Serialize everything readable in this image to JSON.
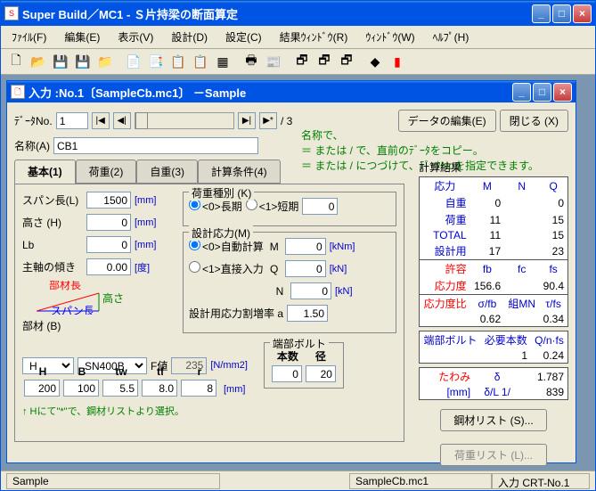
{
  "window": {
    "title": "Super Build／MC1 - Ｓ片持梁の断面算定"
  },
  "menu": {
    "file": "ﾌｧｲﾙ(F)",
    "edit": "編集(E)",
    "view": "表示(V)",
    "design": "設計(D)",
    "settings": "設定(C)",
    "result": "結果ｳｨﾝﾄﾞｳ(R)",
    "win": "ｳｨﾝﾄﾞｳ(W)",
    "help": "ﾍﾙﾌﾟ(H)"
  },
  "subwin": {
    "title": "入力 :No.1〔SampleCb.mc1〕 －Sample"
  },
  "dataNo": {
    "label": "ﾃﾞｰﾀNo.",
    "value": "1",
    "total": "/ 3"
  },
  "hint": {
    "l1": "名称で、",
    "l2": "＝ または / で、直前のﾃﾞｰﾀをコピー。",
    "l3": "＝ または / につづけて、ﾃﾞｰﾀNoを指定できます。"
  },
  "buttons": {
    "edit": "データの編集(E)",
    "close": "閉じる (X)",
    "steel": "鋼材リスト (S)...",
    "load": "荷重リスト (L)..."
  },
  "name": {
    "label": "名称(A)",
    "value": "CB1"
  },
  "tabs": {
    "basic": "基本(1)",
    "load": "荷重(2)",
    "self": "自重(3)",
    "calc": "計算条件(4)"
  },
  "basic": {
    "span": {
      "label": "スパン長(L)",
      "value": "1500",
      "unit": "[mm]"
    },
    "height": {
      "label": "高さ (H)",
      "value": "0",
      "unit": "[mm]"
    },
    "lb": {
      "label": "Lb",
      "value": "0",
      "unit": "[mm]"
    },
    "axis": {
      "label": "主軸の傾き",
      "value": "0.00",
      "unit": "[度]"
    },
    "diag": {
      "top": "部材長",
      "side": "高さ",
      "bottom": "スパン長"
    },
    "member": {
      "label": "部材 (B)",
      "type": "H",
      "steel": "SN400B",
      "flabel": "F値",
      "fval": "235",
      "funit": "[N/mm2]",
      "hH": "H",
      "hB": "B",
      "htw": "tw",
      "htf": "tf",
      "hr": "r",
      "vH": "200",
      "vB": "100",
      "vtw": "5.5",
      "vtf": "8.0",
      "vr": "8",
      "note": "↑ Hにて\"*\"で、鋼材リストより選択。",
      "unit": "[mm]"
    }
  },
  "loadType": {
    "title": "荷重種別 (K)",
    "r0": "<0>長期",
    "r1": "<1>短期",
    "val": "0"
  },
  "designM": {
    "title": "設計応力(M)",
    "r0": "<0>自動計算",
    "r1": "<1>直接入力",
    "M": "M",
    "Mv": "0",
    "Mu": "[kNm]",
    "Q": "Q",
    "Qv": "0",
    "Qu": "[kN]",
    "N": "N",
    "Nv": "0",
    "Nu": "[kN]",
    "ratioL": "設計用応力割増率 a",
    "ratioV": "1.50"
  },
  "bolt": {
    "title": "端部ボルト",
    "hn": "本数",
    "hd": "径",
    "vn": "0",
    "vd": "20"
  },
  "results": {
    "title": "計算結果",
    "hdr": {
      "stress": "応力",
      "M": "M",
      "N": "N",
      "Q": "Q"
    },
    "rows": {
      "self": {
        "l": "自重",
        "m": "0",
        "q": "0"
      },
      "load": {
        "l": "荷重",
        "m": "11",
        "q": "15"
      },
      "total": {
        "l": "TOTAL",
        "m": "11",
        "q": "15"
      },
      "design": {
        "l": "設計用",
        "m": "17",
        "q": "23"
      }
    },
    "allow": {
      "l": "許容",
      "fb": "fb",
      "fc": "fc",
      "fs": "fs",
      "stressL": "応力度",
      "v1": "156.6",
      "v3": "90.4"
    },
    "ratio": {
      "l": "応力度比",
      "c1": "σ/fb",
      "c2": "組MN",
      "c3": "τ/fs",
      "v1": "0.62",
      "v3": "0.34"
    },
    "endbolt": {
      "l": "端部ボルト",
      "c1": "必要本数",
      "c2": "Q/n·fs",
      "v1": "1",
      "v2": "0.24"
    },
    "defl": {
      "l": "たわみ",
      "c1": "δ",
      "v1": "1.787",
      "u": "[mm]",
      "c2": "δ/L 1/",
      "v2": "839"
    }
  },
  "status": {
    "left": "Sample",
    "mid": "SampleCb.mc1",
    "right": "入力 CRT-No.1"
  }
}
